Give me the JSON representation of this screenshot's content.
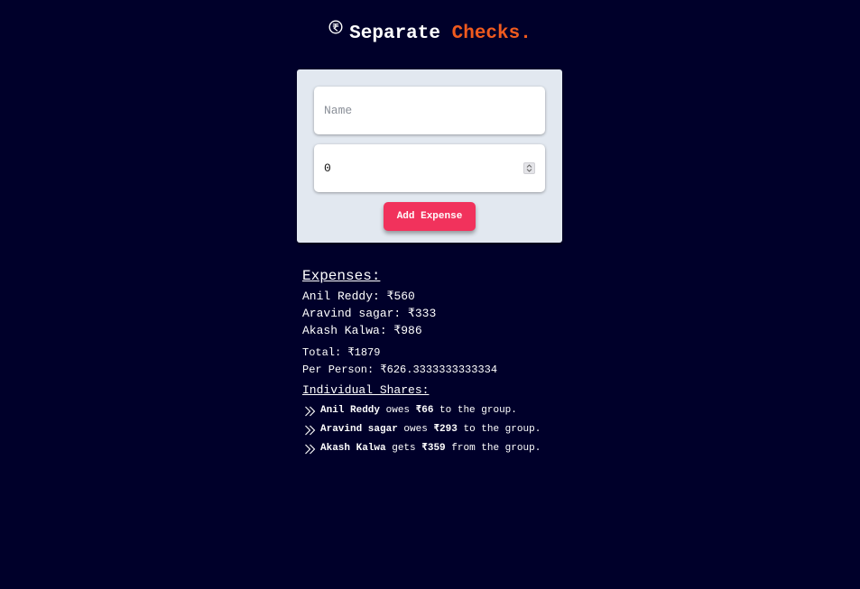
{
  "header": {
    "icon": "rupee-circle-icon",
    "title_part1": "Separate",
    "title_part2": "Checks.",
    "accent_color": "#f05a1e"
  },
  "form": {
    "name_placeholder": "Name",
    "name_value": "",
    "amount_value": "0",
    "add_button_label": "Add Expense",
    "button_color": "#f1325c"
  },
  "expenses": {
    "heading": "Expenses:",
    "items": [
      "Anil Reddy: ₹560",
      "Aravind sagar: ₹333",
      "Akash Kalwa: ₹986"
    ],
    "total": "Total: ₹1879",
    "per_person": "Per Person: ₹626.3333333333334"
  },
  "shares": {
    "heading": "Individual Shares:",
    "icon": "double-chevron-right-icon",
    "items": [
      {
        "name": "Anil Reddy",
        "verb": " owes ",
        "amount": "₹66",
        "suffix": " to the group."
      },
      {
        "name": "Aravind sagar",
        "verb": " owes ",
        "amount": "₹293",
        "suffix": " to the group."
      },
      {
        "name": "Akash Kalwa",
        "verb": " gets ",
        "amount": "₹359",
        "suffix": " from the group."
      }
    ]
  }
}
